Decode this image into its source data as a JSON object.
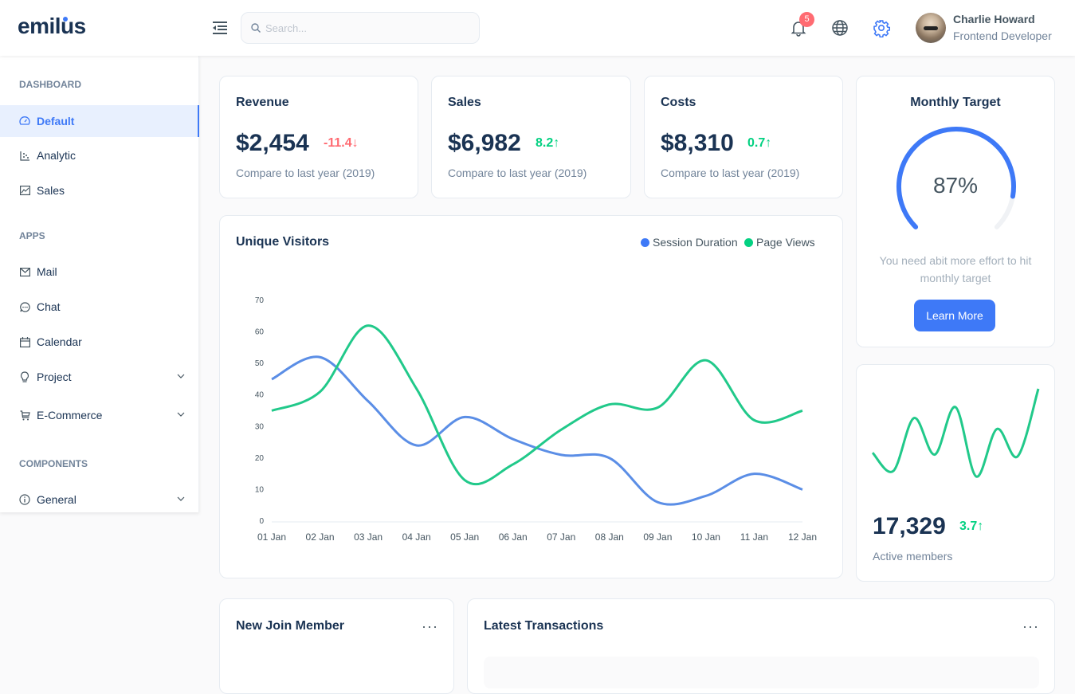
{
  "app": {
    "logo": "emilus"
  },
  "header": {
    "search_placeholder": "Search...",
    "notification_count": "5",
    "user": {
      "name": "Charlie Howard",
      "role": "Frontend Developer"
    }
  },
  "sidebar": {
    "sections": [
      {
        "title": "DASHBOARD"
      },
      {
        "title": "APPS"
      },
      {
        "title": "COMPONENTS"
      }
    ],
    "items": [
      {
        "label": "Default",
        "icon": "dashboard-icon",
        "active": true
      },
      {
        "label": "Analytic",
        "icon": "dot-chart-icon"
      },
      {
        "label": "Sales",
        "icon": "line-chart-icon"
      },
      {
        "label": "Mail",
        "icon": "mail-icon"
      },
      {
        "label": "Chat",
        "icon": "message-icon"
      },
      {
        "label": "Calendar",
        "icon": "calendar-icon"
      },
      {
        "label": "Project",
        "icon": "bulb-icon",
        "expandable": true
      },
      {
        "label": "E-Commerce",
        "icon": "shopping-cart-icon",
        "expandable": true
      },
      {
        "label": "General",
        "icon": "info-circle-icon",
        "expandable": true
      }
    ]
  },
  "kpis": [
    {
      "title": "Revenue",
      "value": "$2,454",
      "change": "-11.4",
      "direction": "down",
      "subtitle": "Compare to last year (2019)"
    },
    {
      "title": "Sales",
      "value": "$6,982",
      "change": "8.2",
      "direction": "up",
      "subtitle": "Compare to last year (2019)"
    },
    {
      "title": "Costs",
      "value": "$8,310",
      "change": "0.7",
      "direction": "up",
      "subtitle": "Compare to last year (2019)"
    }
  ],
  "monthly_target": {
    "title": "Monthly Target",
    "percent": 87,
    "percent_label": "87%",
    "message": "You need abit more effort to hit monthly target",
    "button": "Learn More"
  },
  "active_members": {
    "value": "17,329",
    "change": "3.7",
    "label": "Active members",
    "sparkline": [
      25,
      15,
      44,
      24,
      50,
      12,
      38,
      23,
      60
    ]
  },
  "bottom": {
    "new_members_title": "New Join Member",
    "transactions_title": "Latest Transactions"
  },
  "colors": {
    "primary": "#3e79f7",
    "success": "#04d182",
    "danger": "#ff6b72",
    "text": "#1a3353"
  },
  "chart_data": {
    "type": "line",
    "title": "Unique Visitors",
    "categories": [
      "01 Jan",
      "02 Jan",
      "03 Jan",
      "04 Jan",
      "05 Jan",
      "06 Jan",
      "07 Jan",
      "08 Jan",
      "09 Jan",
      "10 Jan",
      "11 Jan",
      "12 Jan"
    ],
    "series": [
      {
        "name": "Session Duration",
        "color": "#3e79f7",
        "values": [
          45,
          52,
          38,
          24,
          33,
          26,
          21,
          20,
          6,
          8,
          15,
          10
        ]
      },
      {
        "name": "Page Views",
        "color": "#04d182",
        "values": [
          35,
          41,
          62,
          42,
          13,
          18,
          29,
          37,
          36,
          51,
          32,
          35
        ]
      }
    ],
    "yticks": [
      0,
      10,
      20,
      30,
      40,
      50,
      60,
      70
    ],
    "ylim": [
      0,
      70
    ],
    "xlabel": "",
    "ylabel": "",
    "legend": "top-right",
    "grid": false
  }
}
